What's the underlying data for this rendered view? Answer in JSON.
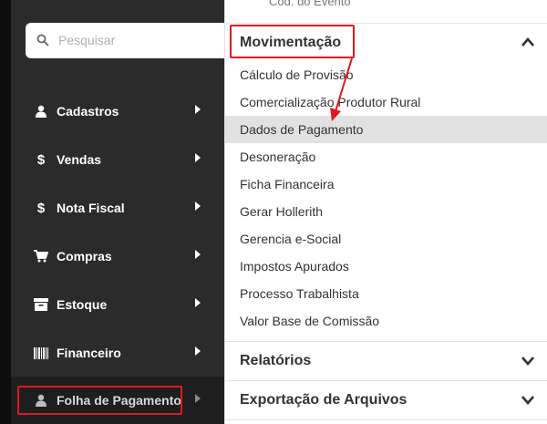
{
  "search": {
    "placeholder": "Pesquisar"
  },
  "sidebar": {
    "items": [
      {
        "label": "Cadastros",
        "icon": "user-icon"
      },
      {
        "label": "Vendas",
        "icon": "dollar-icon"
      },
      {
        "label": "Nota Fiscal",
        "icon": "dollar-icon"
      },
      {
        "label": "Compras",
        "icon": "cart-icon"
      },
      {
        "label": "Estoque",
        "icon": "archive-box-icon"
      },
      {
        "label": "Financeiro",
        "icon": "barcode-icon"
      },
      {
        "label": "Folha de Pagamento",
        "icon": "user-icon",
        "active": true
      }
    ]
  },
  "panel": {
    "top_fragment": "Cód. do Evento",
    "sections": [
      {
        "title": "Movimentação",
        "expanded": true,
        "items": [
          "Cálculo de Provisão",
          "Comercialização Produtor Rural",
          "Dados de Pagamento",
          "Desoneração",
          "Ficha Financeira",
          "Gerar Hollerith",
          "Gerencia e-Social",
          "Impostos Apurados",
          "Processo Trabalhista",
          "Valor Base de Comissão"
        ],
        "selected_index": 2
      },
      {
        "title": "Relatórios",
        "expanded": false
      },
      {
        "title": "Exportação de Arquivos",
        "expanded": false
      }
    ]
  },
  "colors": {
    "annotation": "#e0191f",
    "sidebar_bg": "#2b2b2b",
    "selected_row": "#e1e1e1"
  }
}
